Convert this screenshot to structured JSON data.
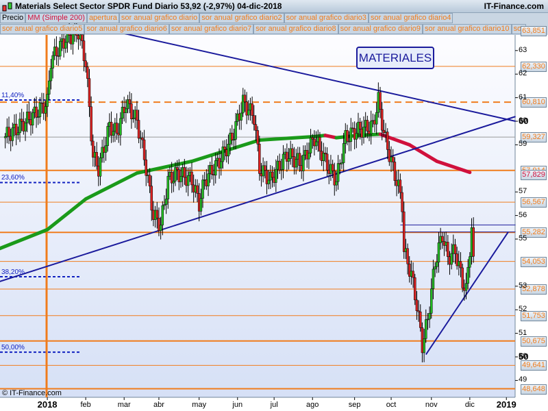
{
  "header": {
    "title": "Materials Select Sector SPDR Fund   Diario   53,92 (-2,97%)   04-dic-2018",
    "site": "IT-Finance.com"
  },
  "legend_row1": [
    "Precio",
    "MM (Simple 200)",
    "apertura",
    "sor anual grafico diario",
    "sor anual grafico diario2",
    "sor anual grafico diario3",
    "sor anual grafico diario4"
  ],
  "legend_row2": [
    "sor anual grafico diario5",
    "sor anual grafico diario6",
    "sor anual grafico diario7",
    "sor anual grafico diario8",
    "sor anual grafico diario9",
    "sor anual grafico diario10",
    "sor"
  ],
  "annotation": "MATERIALES",
  "copyright": "© IT-Finance.com",
  "colors": {
    "level": "#f07c1c",
    "trend": "#1a1a9c",
    "ma_up": "#1a9a1a",
    "ma_down": "#d0103c",
    "fib": "#1020c0"
  },
  "chart_data": {
    "type": "candlestick",
    "title": "Materials Select Sector SPDR Fund Diario",
    "last": "53,92",
    "change": "-2,97%",
    "date": "04-dic-2018",
    "ylim": [
      48.4,
      64.2
    ],
    "y_ticks": [
      {
        "v": 49,
        "t": "49"
      },
      {
        "v": 50,
        "t": "50"
      },
      {
        "v": 51,
        "t": "51"
      },
      {
        "v": 52,
        "t": "52"
      },
      {
        "v": 53,
        "t": "53"
      },
      {
        "v": 55,
        "t": "55"
      },
      {
        "v": 56,
        "t": "56"
      },
      {
        "v": 57,
        "t": "57"
      },
      {
        "v": 59,
        "t": "59"
      },
      {
        "v": 60,
        "t": "60"
      },
      {
        "v": 61,
        "t": "61"
      },
      {
        "v": 62,
        "t": "62"
      },
      {
        "v": 63,
        "t": "63"
      }
    ],
    "x_ticks": [
      {
        "d": -5,
        "t": "dic"
      },
      {
        "d": 24,
        "t": "2018"
      },
      {
        "d": 45,
        "t": "feb"
      },
      {
        "d": 66,
        "t": "mar"
      },
      {
        "d": 85,
        "t": "abr"
      },
      {
        "d": 107,
        "t": "may"
      },
      {
        "d": 128,
        "t": "jun"
      },
      {
        "d": 148,
        "t": "jul"
      },
      {
        "d": 169,
        "t": "ago"
      },
      {
        "d": 192,
        "t": "sep"
      },
      {
        "d": 212,
        "t": "oct"
      },
      {
        "d": 234,
        "t": "nov"
      },
      {
        "d": 255,
        "t": "dic"
      },
      {
        "d": 275,
        "t": "2019"
      }
    ],
    "levels": [
      {
        "v": 63.851,
        "t": "63,851"
      },
      {
        "v": 62.33,
        "t": "62,330"
      },
      {
        "v": 60.81,
        "t": "60,810",
        "dashed": true
      },
      {
        "v": 59.327,
        "t": "59,327"
      },
      {
        "v": 57.914,
        "t": "57,914"
      },
      {
        "v": 56.567,
        "t": "56,567"
      },
      {
        "v": 55.282,
        "t": "55,282"
      },
      {
        "v": 54.053,
        "t": "54,053"
      },
      {
        "v": 52.878,
        "t": "52,878"
      },
      {
        "v": 51.753,
        "t": "51,753"
      },
      {
        "v": 50.675,
        "t": "50,675"
      },
      {
        "v": 49.641,
        "t": "49,641"
      },
      {
        "v": 48.648,
        "t": "48,648"
      }
    ],
    "ma_label": {
      "v": 57.829,
      "t": "57,829"
    },
    "fib": [
      {
        "v": 60.9,
        "t": "11,40%"
      },
      {
        "v": 57.4,
        "t": "23,60%"
      },
      {
        "v": 53.4,
        "t": "38,20%"
      },
      {
        "v": 50.2,
        "t": "50,00%"
      }
    ],
    "price_path": [
      [
        0,
        59.3
      ],
      [
        6,
        59.6
      ],
      [
        17,
        60.3
      ],
      [
        24,
        60.8
      ],
      [
        26,
        62.6
      ],
      [
        34,
        63.5
      ],
      [
        41,
        63.8
      ],
      [
        45,
        62.5
      ],
      [
        49,
        58.5
      ],
      [
        52,
        58
      ],
      [
        58,
        59.8
      ],
      [
        62,
        59.5
      ],
      [
        67,
        60.8
      ],
      [
        73,
        60
      ],
      [
        77,
        58.5
      ],
      [
        82,
        56
      ],
      [
        86,
        55.6
      ],
      [
        90,
        57.5
      ],
      [
        95,
        57.8
      ],
      [
        103,
        57.5
      ],
      [
        107,
        56.5
      ],
      [
        110,
        57.5
      ],
      [
        118,
        58.3
      ],
      [
        125,
        59.3
      ],
      [
        131,
        60.8
      ],
      [
        137,
        60.2
      ],
      [
        140,
        58
      ],
      [
        146,
        57.5
      ],
      [
        155,
        58.6
      ],
      [
        163,
        58.2
      ],
      [
        170,
        59.3
      ],
      [
        178,
        58
      ],
      [
        182,
        57.5
      ],
      [
        187,
        59.3
      ],
      [
        193,
        59.6
      ],
      [
        202,
        59.8
      ],
      [
        205,
        60.9
      ],
      [
        208,
        59.5
      ],
      [
        213,
        58
      ],
      [
        216,
        57.2
      ],
      [
        218,
        56.5
      ],
      [
        219,
        54.5
      ],
      [
        223,
        53.5
      ],
      [
        226,
        52.2
      ],
      [
        229,
        50.5
      ],
      [
        232,
        51.6
      ],
      [
        236,
        54
      ],
      [
        240,
        55.2
      ],
      [
        243,
        54.2
      ],
      [
        247,
        54.5
      ],
      [
        251,
        53.2
      ],
      [
        253,
        52.8
      ],
      [
        256,
        55.5
      ],
      [
        257,
        53.92
      ]
    ],
    "ma200": [
      [
        -2,
        54.6
      ],
      [
        24,
        55.4
      ],
      [
        45,
        56.7
      ],
      [
        73,
        57.8
      ],
      [
        103,
        58.3
      ],
      [
        140,
        59.2
      ],
      [
        170,
        59.35
      ],
      [
        176,
        59.4
      ],
      [
        182,
        59.3
      ],
      [
        194,
        59.4
      ],
      [
        206,
        59.45
      ],
      [
        222,
        59.0
      ],
      [
        237,
        58.3
      ],
      [
        255,
        57.83
      ]
    ],
    "trendlines": [
      [
        [
          56,
          63.9
        ],
        [
          280,
          60
        ]
      ],
      [
        [
          -2,
          53.2
        ],
        [
          280,
          60.2
        ]
      ],
      [
        [
          231,
          50.1
        ],
        [
          276,
          55.3
        ]
      ],
      [
        [
          217,
          55.6
        ],
        [
          280,
          55.6
        ]
      ],
      [
        [
          217,
          55.3
        ],
        [
          280,
          55.3
        ]
      ]
    ]
  }
}
